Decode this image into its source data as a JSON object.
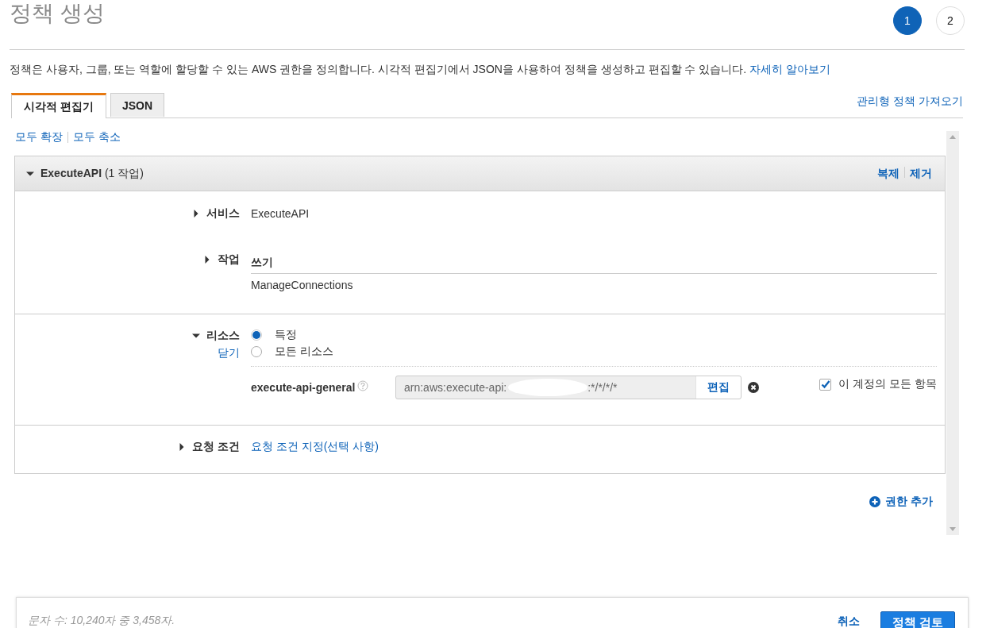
{
  "title": "정책 생성",
  "steps": [
    {
      "label": "1",
      "selected": true
    },
    {
      "label": "2",
      "selected": false
    }
  ],
  "description": {
    "text": "정책은 사용자, 그룹, 또는 역할에 할당할 수 있는 AWS 권한을 정의합니다. 시각적 편집기에서 JSON을 사용하여 정책을 생성하고 편집할 수 있습니다.",
    "link": "자세히 알아보기"
  },
  "tabs": [
    {
      "label": "시각적 편집기",
      "selected": true
    },
    {
      "label": "JSON",
      "selected": false
    }
  ],
  "import_link": "관리형 정책 가져오기",
  "expand_links": [
    "모두 확장",
    "모두 축소"
  ],
  "permission": {
    "service_name": "ExecuteAPI",
    "count": "(1 작업)",
    "expanded": true,
    "actions": [
      "복제",
      "제거"
    ],
    "service": {
      "label": "서비스",
      "expanded": false,
      "value": "ExecuteAPI"
    },
    "action": {
      "label": "작업",
      "expanded": false,
      "group": "쓰기",
      "value": "ManageConnections"
    },
    "resources": {
      "label": "리소스",
      "expanded": true,
      "close_link": "닫기",
      "options": [
        {
          "label": "특정",
          "selected": true
        },
        {
          "label": "모든 리소스",
          "selected": false
        }
      ],
      "resource_name": "execute-api-general",
      "arn_prefix": "arn:aws:execute-api:",
      "arn_suffix": ":*/*/*/*",
      "edit_button": "편집",
      "all_in_account": {
        "label": "이 계정의 모든 항목",
        "checked": true
      }
    },
    "conditions": {
      "label": "요청 조건",
      "expanded": false,
      "link": "요청 조건 지정(선택 사항)"
    }
  },
  "add_permission": "권한 추가",
  "footer": {
    "char_count": "문자 수: 10,240자 중 3,458자.",
    "cancel": "취소",
    "review": "정책 검토"
  }
}
